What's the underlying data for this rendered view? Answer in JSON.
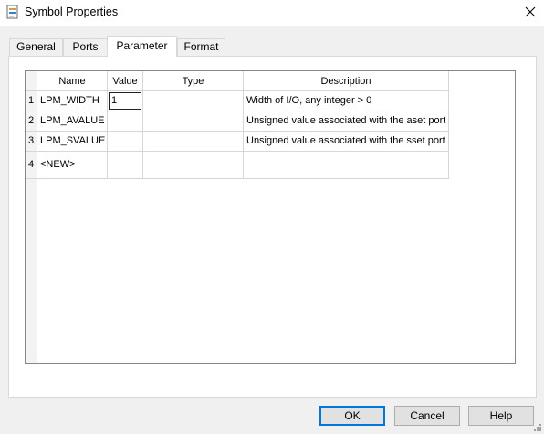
{
  "window": {
    "title": "Symbol Properties",
    "app_icon": "symbol-file-icon",
    "close_icon": "close-icon"
  },
  "tabs": [
    {
      "label": "General",
      "active": false
    },
    {
      "label": "Ports",
      "active": false
    },
    {
      "label": "Parameter",
      "active": true
    },
    {
      "label": "Format",
      "active": false
    }
  ],
  "grid": {
    "columns": [
      "Name",
      "Value",
      "Type",
      "Description"
    ],
    "rows": [
      {
        "num": "1",
        "name": "LPM_WIDTH",
        "value": "1",
        "type": "",
        "description": "Width of I/O, any integer > 0"
      },
      {
        "num": "2",
        "name": "LPM_AVALUE",
        "value": "",
        "type": "",
        "description": "Unsigned value associated with the aset port"
      },
      {
        "num": "3",
        "name": "LPM_SVALUE",
        "value": "",
        "type": "",
        "description": "Unsigned value associated with the sset port"
      },
      {
        "num": "4",
        "name": "<NEW>",
        "value": "",
        "type": "",
        "description": ""
      }
    ]
  },
  "buttons": {
    "ok": "OK",
    "cancel": "Cancel",
    "help": "Help"
  },
  "colors": {
    "default_button_border": "#0078d7",
    "grid_border": "#828790"
  }
}
